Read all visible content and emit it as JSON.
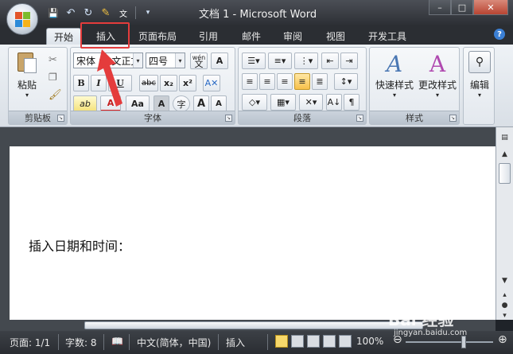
{
  "window": {
    "title": "文档 1 - Microsoft Word",
    "controls": {
      "minimize": "–",
      "maximize": "□",
      "close": "✕"
    }
  },
  "qat": {
    "save": "💾",
    "undo": "↶",
    "redo": "↻",
    "customize": "▾"
  },
  "tabs": [
    {
      "label": "开始",
      "active": true
    },
    {
      "label": "插入",
      "active": false
    },
    {
      "label": "页面布局",
      "active": false
    },
    {
      "label": "引用",
      "active": false
    },
    {
      "label": "邮件",
      "active": false
    },
    {
      "label": "审阅",
      "active": false
    },
    {
      "label": "视图",
      "active": false
    },
    {
      "label": "开发工具",
      "active": false
    }
  ],
  "ribbon": {
    "clipboard": {
      "label": "剪贴板",
      "paste": "粘贴"
    },
    "font": {
      "label": "字体",
      "font_name": "宋体 (中文正文)",
      "font_size": "四号",
      "wen": "wén",
      "bold": "B",
      "italic": "I",
      "underline": "U",
      "strike": "abc",
      "subscript": "x₂",
      "superscript": "x²",
      "highlight": "ab",
      "font_color": "A",
      "change_case": "Aa",
      "char_shading": "A",
      "enclose": "字",
      "grow": "A",
      "shrink": "A"
    },
    "paragraph": {
      "label": "段落"
    },
    "styles": {
      "label": "样式",
      "quick": "快速样式",
      "change": "更改样式"
    },
    "editing": {
      "label": "编辑"
    }
  },
  "document": {
    "text": "插入日期和时间："
  },
  "status": {
    "page": "页面: 1/1",
    "words": "字数: 8",
    "language": "中文(简体，中国)",
    "mode": "插入",
    "zoom": "100%"
  },
  "watermark": {
    "text": "Bai 经验",
    "url": "jingyan.baidu.com"
  }
}
